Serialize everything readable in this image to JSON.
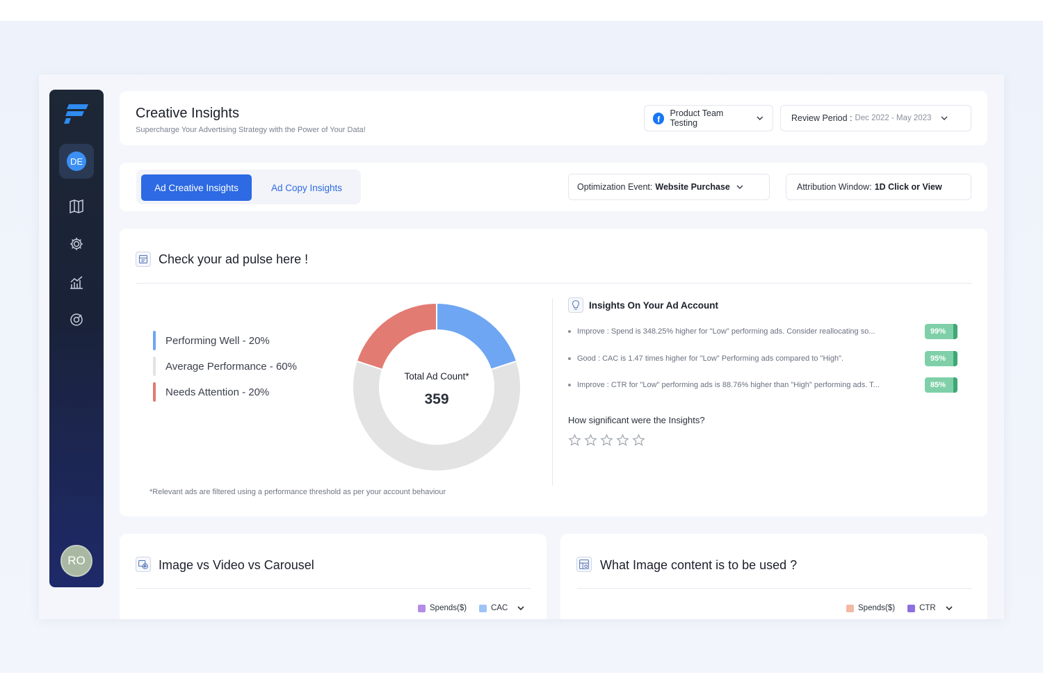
{
  "header": {
    "title": "Creative Insights",
    "subtitle": "Supercharge Your Advertising Strategy with the Power of Your Data!",
    "account_label": "Product Team Testing",
    "review_period_label": "Review Period :",
    "review_period_value": "Dec 2022 - May 2023"
  },
  "sidebar": {
    "user_initials": "DE",
    "bottom_initials": "RO",
    "icons": [
      "map-icon",
      "settings-icon",
      "analytics-icon",
      "target-icon"
    ]
  },
  "tabs": {
    "items": [
      {
        "label": "Ad Creative Insights",
        "active": true
      },
      {
        "label": "Ad Copy Insights",
        "active": false
      }
    ],
    "optimization_label": "Optimization Event:",
    "optimization_value": "Website Purchase",
    "attribution_label": "Attribution Window:",
    "attribution_value": "1D Click or View"
  },
  "pulse": {
    "title": "Check your ad pulse here !",
    "legend": [
      {
        "label": "Performing Well - 20%",
        "color": "#6ea6f3"
      },
      {
        "label": "Average Performance - 60%",
        "color": "#e3e3e3"
      },
      {
        "label": "Needs Attention - 20%",
        "color": "#e27b72"
      }
    ],
    "donut_center_label": "Total Ad Count*",
    "donut_center_value": "359",
    "footnote": "*Relevant ads are filtered using a performance threshold as per your account behaviour"
  },
  "chart_data": {
    "type": "pie",
    "categories": [
      "Performing Well",
      "Average Performance",
      "Needs Attention"
    ],
    "values": [
      20,
      60,
      20
    ],
    "colors": [
      "#6ea6f3",
      "#e3e3e3",
      "#e27b72"
    ]
  },
  "insights": {
    "title": "Insights On Your Ad Account",
    "items": [
      {
        "text": "Improve : Spend is 348.25% higher for \"Low\" performing ads. Consider reallocating so...",
        "badge": "99%"
      },
      {
        "text": "Good : CAC is 1.47 times higher for \"Low\" Performing ads compared to \"High\".",
        "badge": "95%"
      },
      {
        "text": "Improve : CTR for \"Low\" performing ads is 88.76% higher than \"High\" performing ads. T...",
        "badge": "85%"
      }
    ],
    "rating_question": "How significant were the Insights?",
    "rating_value": 0,
    "rating_max": 5
  },
  "image_vs_video": {
    "title": "Image vs Video vs Carousel",
    "legend": [
      {
        "label": "Spends($)",
        "color": "#b58be8"
      },
      {
        "label": "CAC",
        "color": "#9fc3f5"
      }
    ]
  },
  "image_content": {
    "title": "What Image content is to be used ?",
    "legend": [
      {
        "label": "Spends($)",
        "color": "#f2b9a3"
      },
      {
        "label": "CTR",
        "color": "#8e6fe0"
      }
    ]
  }
}
